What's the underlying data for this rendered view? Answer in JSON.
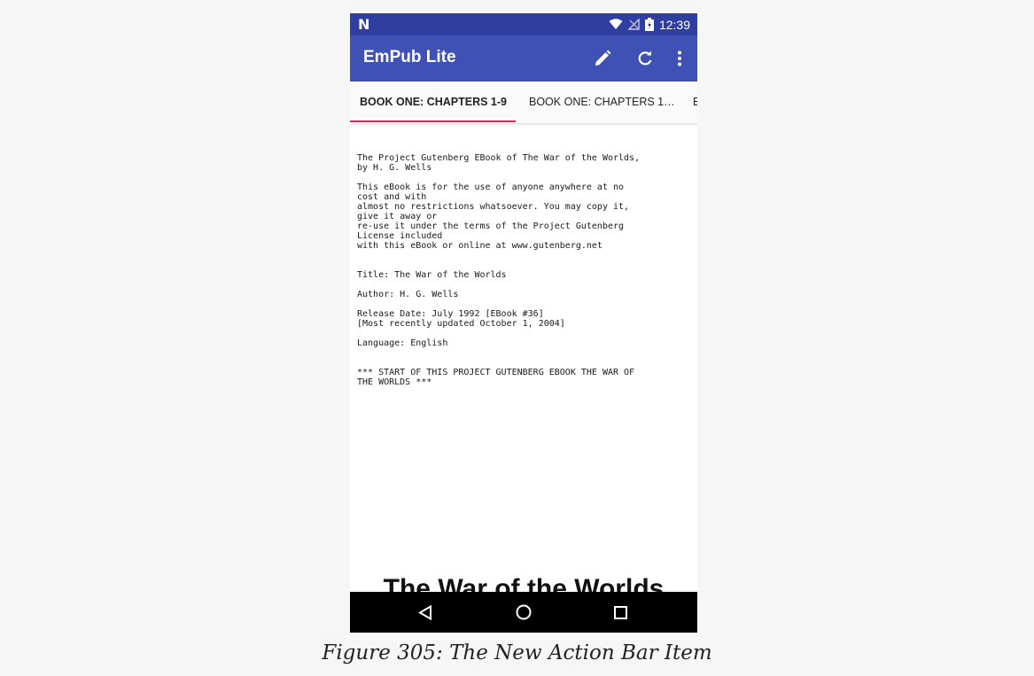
{
  "status_bar": {
    "notification_icon": "N",
    "time": "12:39",
    "icons": [
      "wifi-icon",
      "no-signal-icon",
      "battery-icon"
    ]
  },
  "app_bar": {
    "title": "EmPub Lite",
    "actions": [
      "edit-icon",
      "refresh-icon",
      "overflow-menu-icon"
    ]
  },
  "tabs": {
    "items": [
      {
        "label": "BOOK ONE: CHAPTERS 1-9",
        "active": true
      },
      {
        "label": "BOOK ONE: CHAPTERS 1…",
        "active": false
      },
      {
        "label": "E",
        "active": false
      }
    ],
    "indicator_color": "#e91e63"
  },
  "content": {
    "paragraphs": [
      "The Project Gutenberg EBook of The War of the Worlds,\nby H. G. Wells",
      "This eBook is for the use of anyone anywhere at no\ncost and with\nalmost no restrictions whatsoever. You may copy it,\ngive it away or\nre-use it under the terms of the Project Gutenberg\nLicense included\nwith this eBook or online at www.gutenberg.net",
      "Title: The War of the Worlds",
      "Author: H. G. Wells",
      "Release Date: July 1992 [EBook #36]\n[Most recently updated October 1, 2004]",
      "Language: English",
      "*** START OF THIS PROJECT GUTENBERG EBOOK THE WAR OF\nTHE WORLDS ***"
    ],
    "heading": "The War of the Worlds"
  },
  "nav_bar": {
    "buttons": [
      "back-icon",
      "home-icon",
      "recents-icon"
    ]
  },
  "caption": "Figure 305: The New Action Bar Item",
  "colors": {
    "status_bar": "#303f9f",
    "app_bar": "#3f51b5",
    "accent": "#e91e63",
    "page_background": "#f6f6f6"
  }
}
